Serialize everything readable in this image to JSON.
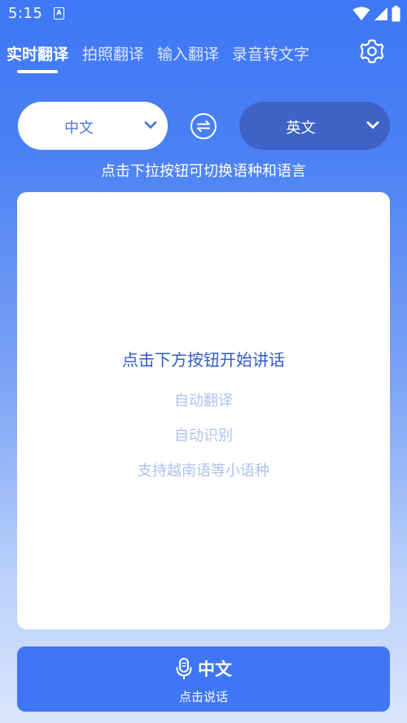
{
  "status_bar": {
    "time": "5:15",
    "app_icon_letter": "A"
  },
  "tabs": [
    {
      "label": "实时翻译",
      "active": true
    },
    {
      "label": "拍照翻译",
      "active": false
    },
    {
      "label": "输入翻译",
      "active": false
    },
    {
      "label": "录音转文字",
      "active": false
    }
  ],
  "language_selector": {
    "source": "中文",
    "target": "英文",
    "hint": "点击下拉按钮可切换语种和语言"
  },
  "card": {
    "title": "点击下方按钮开始讲话",
    "features": [
      "自动翻译",
      "自动识别",
      "支持越南语等小语种"
    ]
  },
  "speak_button": {
    "language": "中文",
    "label": "点击说话"
  },
  "colors": {
    "primary": "#3E76F5",
    "target_pill": "#3E62C6",
    "card_title": "#2F5CC8",
    "feature_text": "#AFC3EC"
  }
}
